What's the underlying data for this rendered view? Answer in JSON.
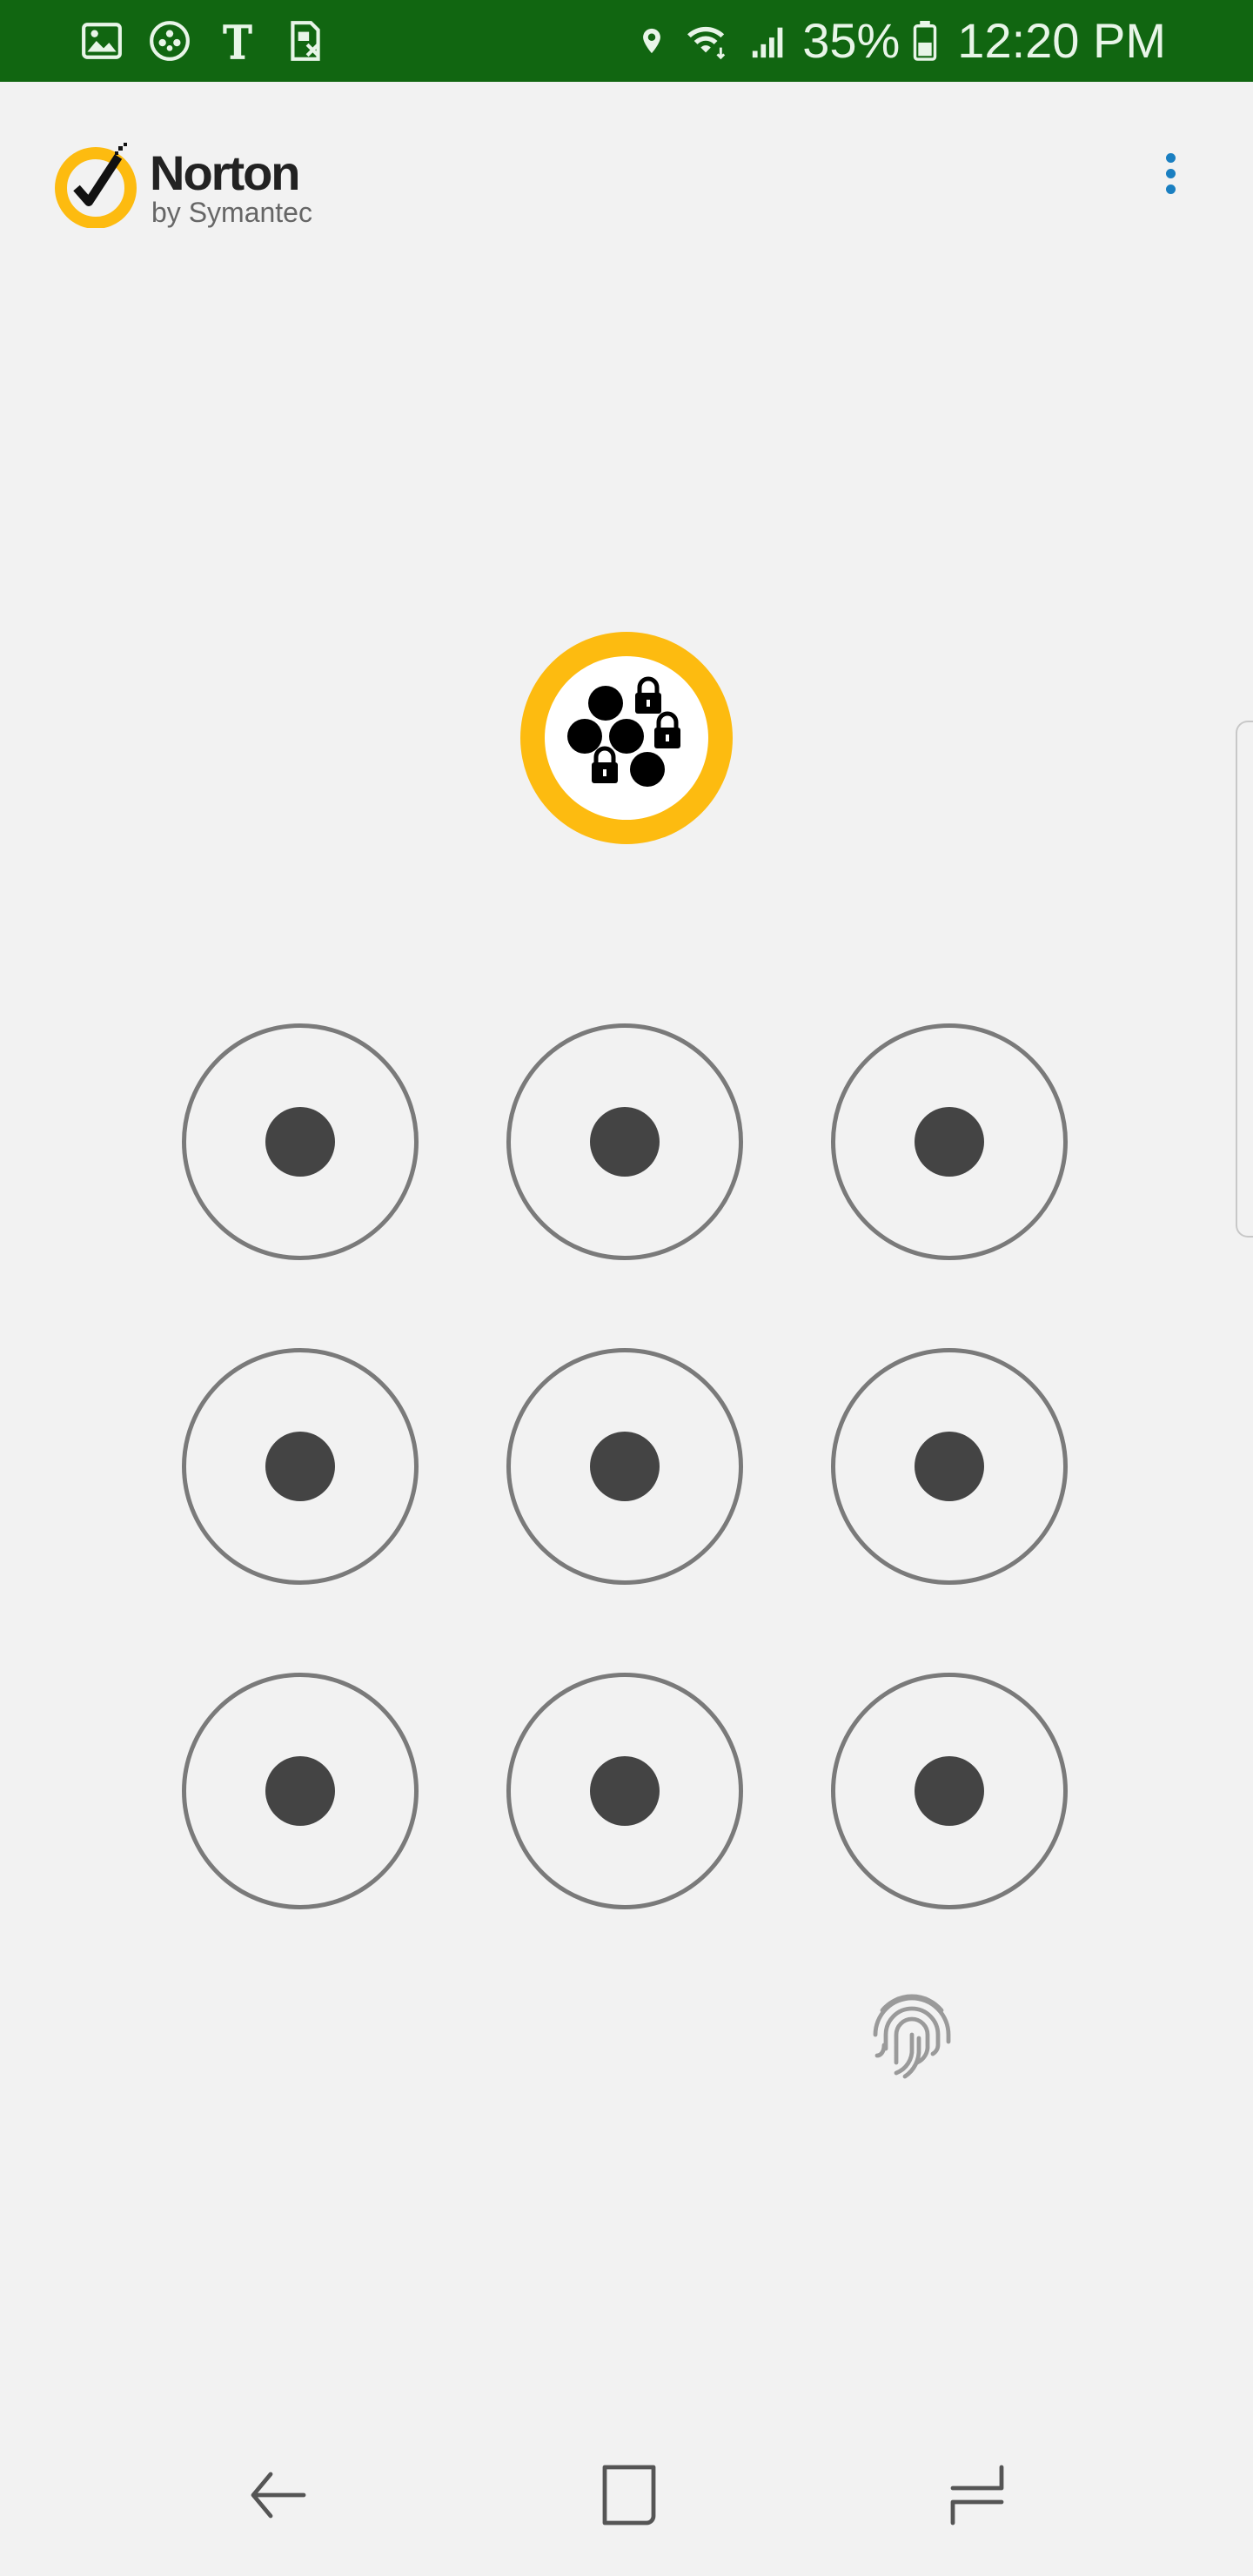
{
  "status_bar": {
    "battery_percent": "35%",
    "time": "12:20 PM",
    "left_icons": [
      "gallery-icon",
      "app-icon",
      "tmobile-icon",
      "sim-icon"
    ],
    "right_icons": [
      "location-icon",
      "wifi-icon",
      "signal-icon",
      "battery-icon"
    ]
  },
  "header": {
    "brand": "Norton",
    "brand_sub": "by Symantec",
    "menu_icon": "overflow-menu-icon"
  },
  "lock_screen": {
    "app_icon": "app-lock-icon",
    "pattern_nodes": 9,
    "fingerprint_icon": "fingerprint-icon"
  },
  "nav_bar": {
    "buttons": [
      "back-icon",
      "home-icon",
      "recents-icon"
    ]
  },
  "colors": {
    "status_bar": "#116611",
    "background": "#f2f2f2",
    "accent": "#1a7fc1",
    "norton_yellow": "#fdbb10",
    "ring": "#7a7a7a",
    "dot": "#444444"
  }
}
